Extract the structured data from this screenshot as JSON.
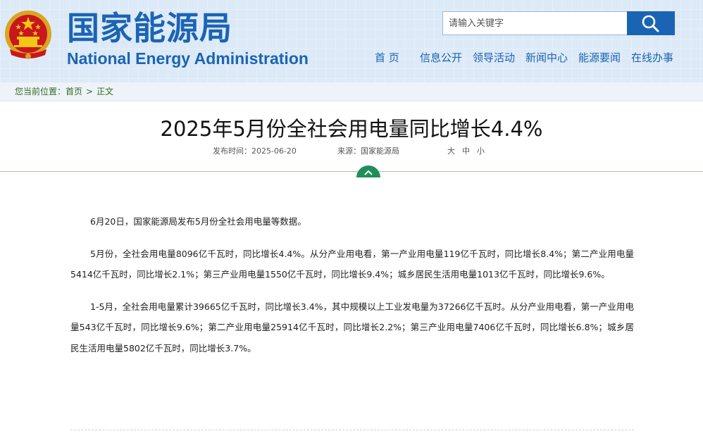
{
  "header": {
    "title_cn": "国家能源局",
    "title_en": "National Energy Administration",
    "search_placeholder": "请输入关键字",
    "nav": [
      "首 页",
      "信息公开",
      "领导活动",
      "新闻中心",
      "能源要闻",
      "在线办事"
    ]
  },
  "breadcrumb": {
    "label": "您当前位置：",
    "home": "首页",
    "current": "正文"
  },
  "article": {
    "title": "2025年5月份全社会用电量同比增长4.4%",
    "pub_label": "发布时间：2025-06-20",
    "source_label": "来源：国家能源局",
    "font_sizes": [
      "大",
      "中",
      "小"
    ],
    "paragraphs": [
      "6月20日，国家能源局发布5月份全社会用电量等数据。",
      "5月份，全社会用电量8096亿千瓦时，同比增长4.4%。从分产业用电看，第一产业用电量119亿千瓦时，同比增长8.4%；第二产业用电量5414亿千瓦时，同比增长2.1%；第三产业用电量1550亿千瓦时，同比增长9.4%；城乡居民生活用电量1013亿千瓦时，同比增长9.6%。",
      "1-5月，全社会用电量累计39665亿千瓦时，同比增长3.4%，其中规模以上工业发电量为37266亿千瓦时。从分产业用电看，第一产业用电量543亿千瓦时，同比增长9.6%；第二产业用电量25914亿千瓦时，同比增长2.2%；第三产业用电量7406亿千瓦时，同比增长6.8%；城乡居民生活用电量5802亿千瓦时，同比增长3.7%。"
    ]
  },
  "colors": {
    "brand_blue": "#1a64b4",
    "header_bg": "#dce9f7",
    "breadcrumb_green": "#3a6b1f",
    "toggle_green": "#1e8f5a"
  }
}
